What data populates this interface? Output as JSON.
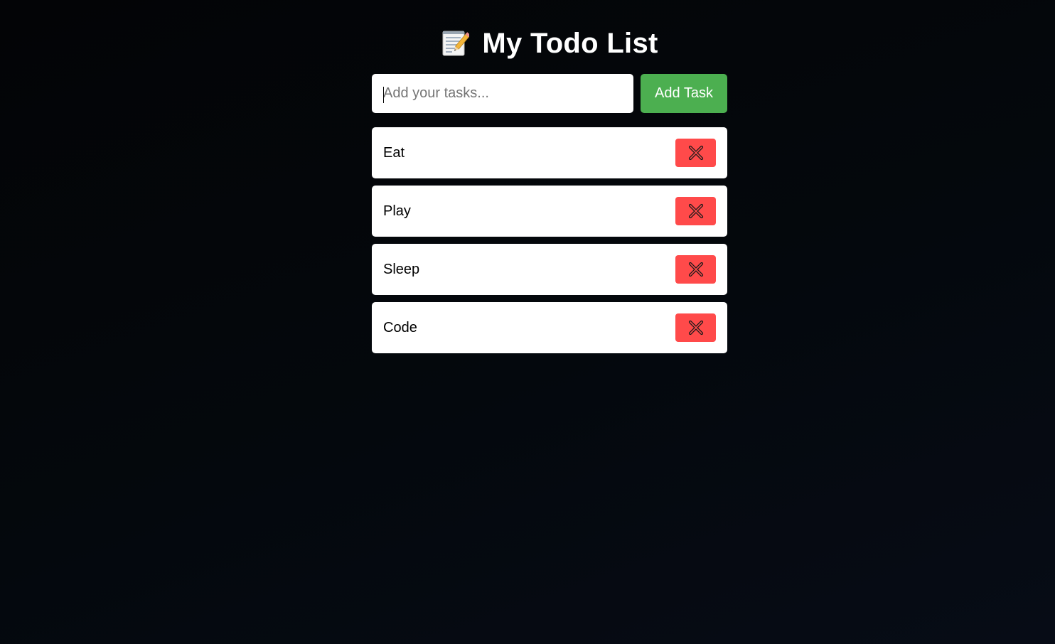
{
  "header": {
    "icon": "memo-icon",
    "title": "My Todo List"
  },
  "input": {
    "placeholder": "Add your tasks...",
    "value": ""
  },
  "add_button": {
    "label": "Add Task",
    "color": "#4caf50"
  },
  "tasks": [
    {
      "label": "Eat",
      "delete_icon": "cross-mark-icon"
    },
    {
      "label": "Play",
      "delete_icon": "cross-mark-icon"
    },
    {
      "label": "Sleep",
      "delete_icon": "cross-mark-icon"
    },
    {
      "label": "Code",
      "delete_icon": "cross-mark-icon"
    }
  ],
  "colors": {
    "background": "#04070c",
    "delete_button": "#ff4a4a",
    "card": "#ffffff"
  }
}
